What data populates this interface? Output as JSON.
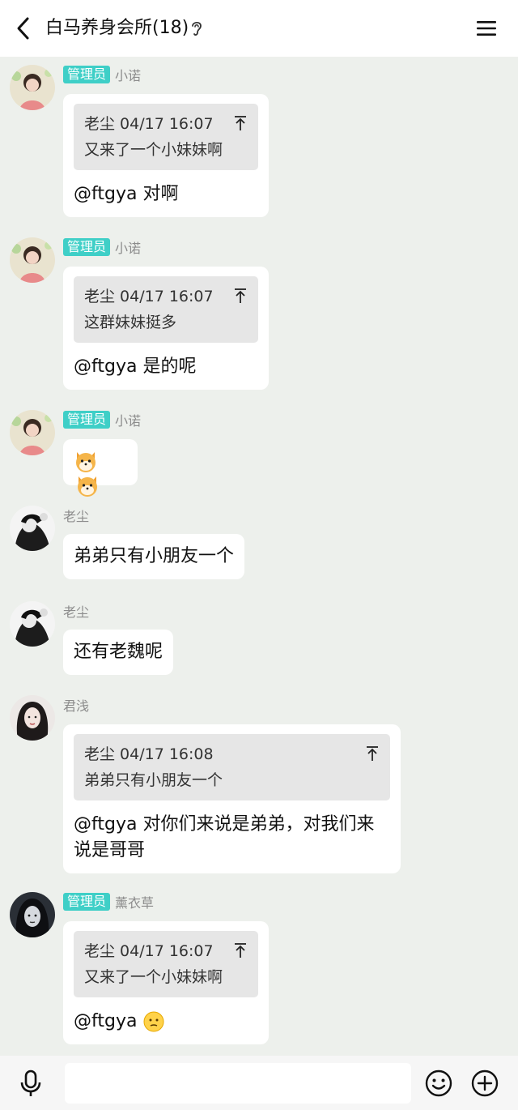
{
  "header": {
    "title": "白马养身会所(18)",
    "back_icon": "chevron-left-icon",
    "ear_icon": "ear-icon",
    "menu_icon": "hamburger-menu-icon"
  },
  "colors": {
    "admin_badge": "#3fcfc7",
    "background": "#edf0ec",
    "bubble": "#ffffff",
    "quote": "#e6e6e6"
  },
  "messages": [
    {
      "badge": "管理员",
      "sender": "小诺",
      "quote": {
        "header": "老尘 04/17 16:07",
        "text": "又来了一个小妹妹啊"
      },
      "text": "@ftgya 对啊"
    },
    {
      "badge": "管理员",
      "sender": "小诺",
      "quote": {
        "header": "老尘 04/17 16:07",
        "text": "这群妹妹挺多"
      },
      "text": "@ftgya 是的呢"
    },
    {
      "badge": "管理员",
      "sender": "小诺",
      "emoji": [
        "shiba-dog-emoji",
        "shiba-dog-emoji"
      ]
    },
    {
      "sender": "老尘",
      "text": "弟弟只有小朋友一个"
    },
    {
      "sender": "老尘",
      "text": "还有老魏呢"
    },
    {
      "sender": "君浅",
      "quote": {
        "header": "老尘 04/17 16:08",
        "text": "弟弟只有小朋友一个"
      },
      "text_lines": [
        "@ftgya 对你们来说是弟弟，对我们来",
        "说是哥哥"
      ]
    },
    {
      "badge": "管理员",
      "sender": "薰衣草",
      "quote": {
        "header": "老尘 04/17 16:07",
        "text": "又来了一个小妹妹啊"
      },
      "text": "@ftgya",
      "trailing_emoji": "thinking-face-emoji"
    }
  ],
  "input_bar": {
    "mic_icon": "microphone-icon",
    "input_value": "",
    "emoji_icon": "smiley-icon",
    "plus_icon": "plus-circle-icon"
  }
}
